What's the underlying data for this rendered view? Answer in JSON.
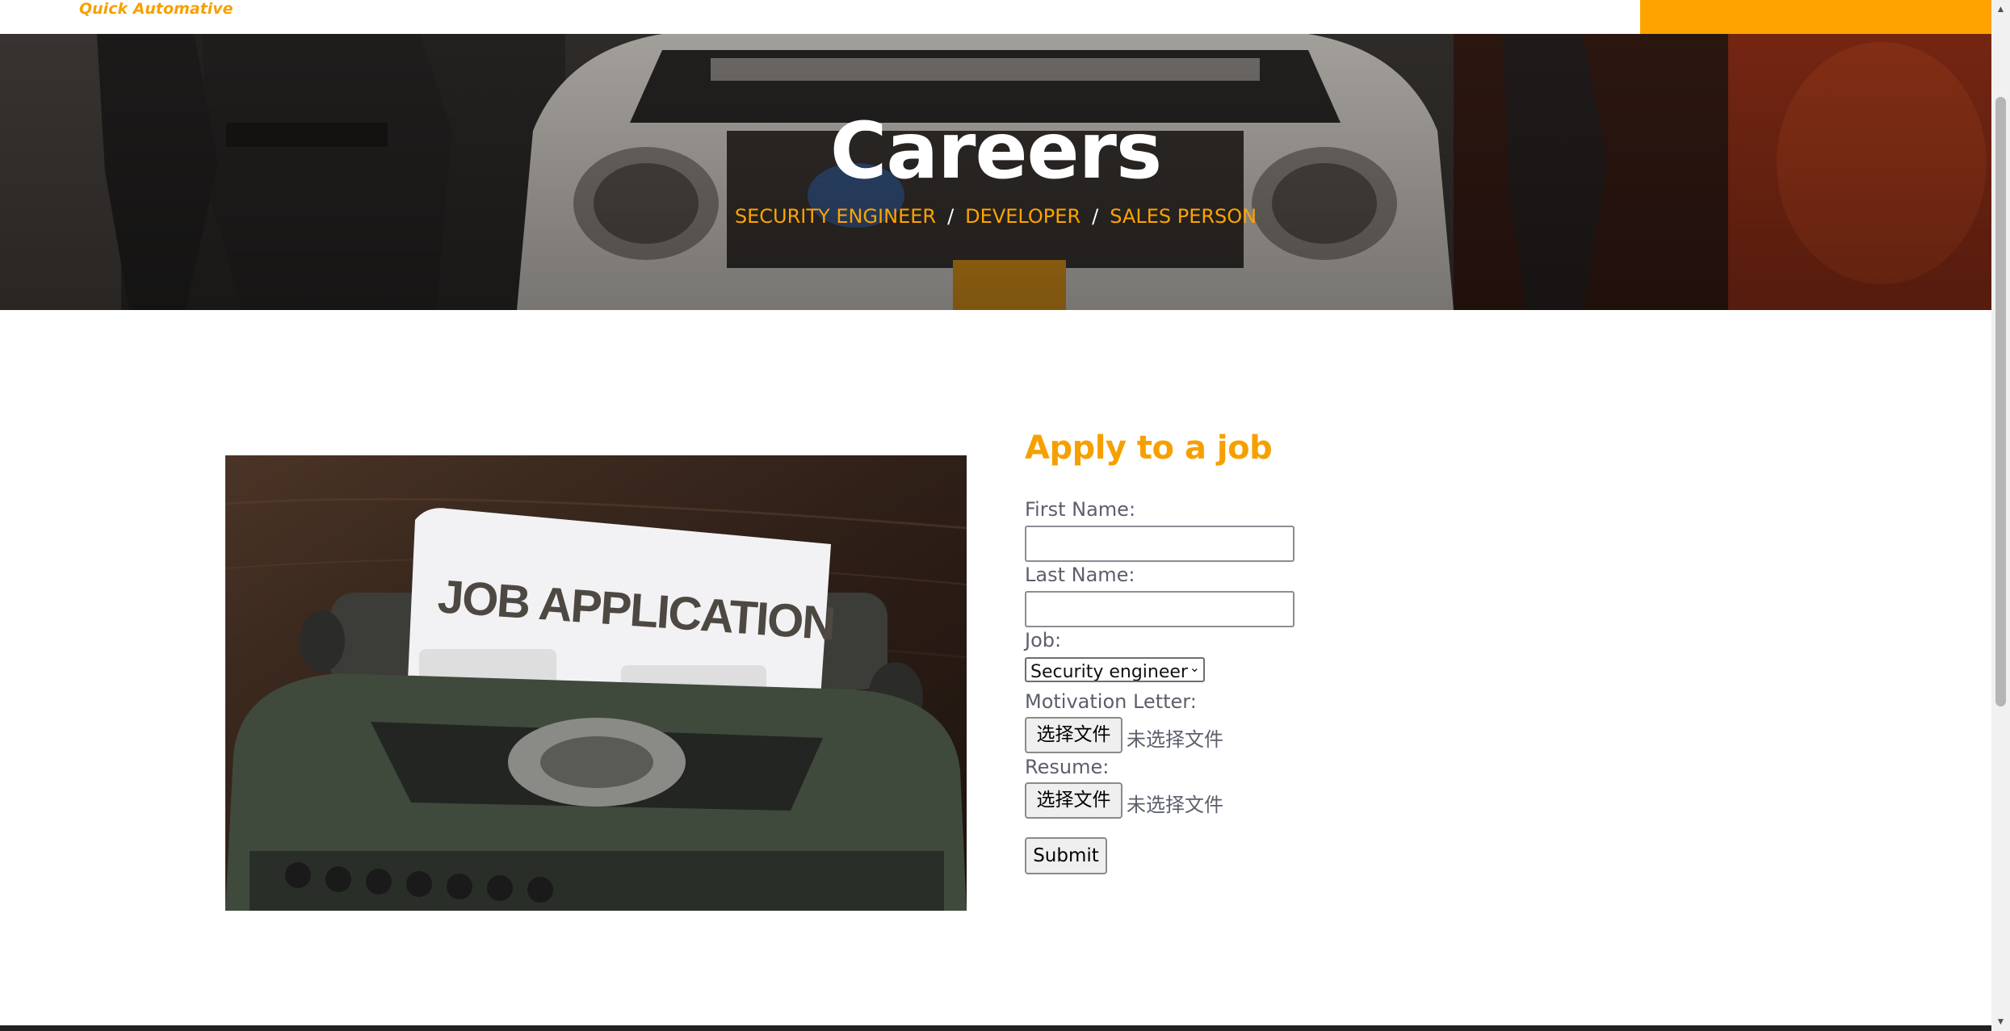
{
  "navbar": {
    "brand": "Quick Automative"
  },
  "hero": {
    "title": "Careers",
    "breadcrumb": [
      "SECURITY ENGINEER",
      "DEVELOPER",
      "SALES PERSON"
    ],
    "separator": "/"
  },
  "image": {
    "caption": "JOB APPLICATION"
  },
  "form": {
    "heading": "Apply to a job",
    "first_name_label": "First Name:",
    "first_name_value": "",
    "last_name_label": "Last Name:",
    "last_name_value": "",
    "job_label": "Job:",
    "job_selected": "Security engineer",
    "motivation_label": "Motivation Letter:",
    "resume_label": "Resume:",
    "choose_file_label": "选择文件",
    "no_file_label": "未选择文件",
    "submit_label": "Submit"
  },
  "colors": {
    "accent": "#ffa300",
    "label_text": "#5c5f6b"
  }
}
